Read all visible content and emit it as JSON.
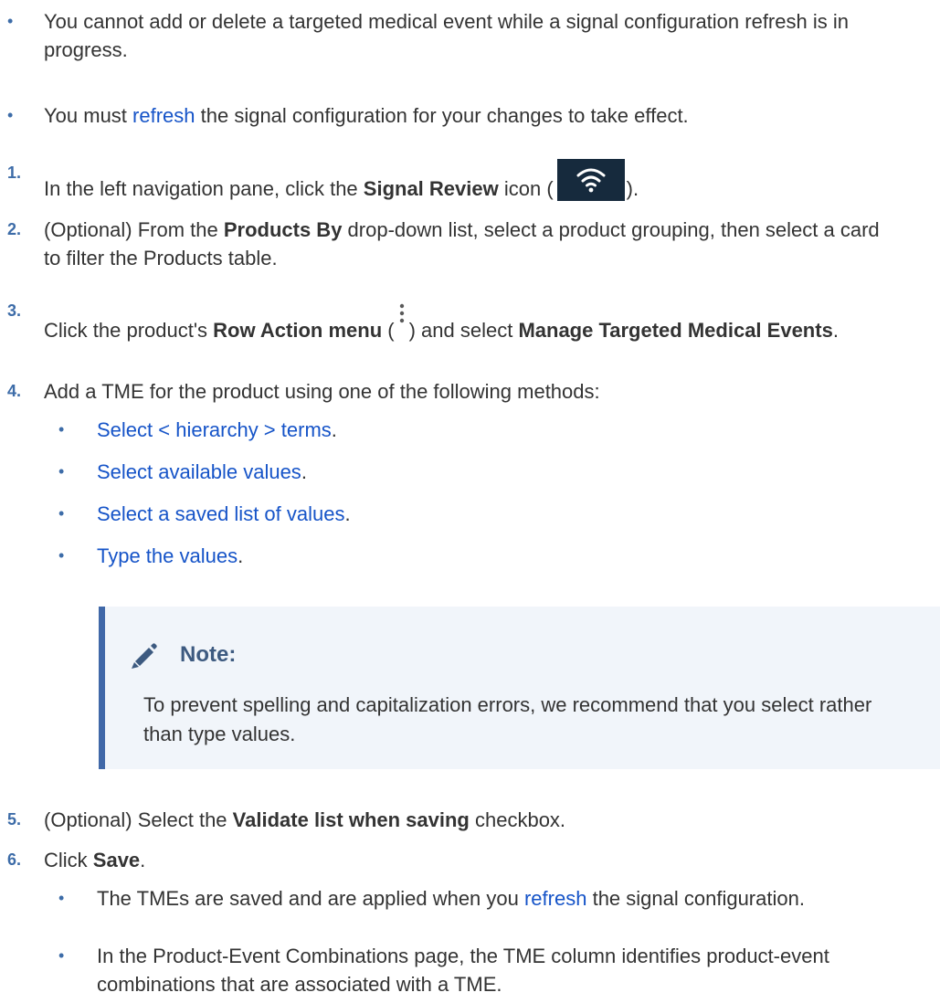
{
  "bullets_top": [
    {
      "text": "You cannot add or delete a targeted medical event while a signal configuration refresh is in progress."
    },
    {
      "pre": "You must ",
      "link": "refresh",
      "post": " the signal configuration for your changes to take effect."
    }
  ],
  "steps": {
    "s1": {
      "number": "1.",
      "pre": "In the left navigation pane, click the ",
      "bold": "Signal Review",
      "mid": " icon (",
      "post": ")."
    },
    "s2": {
      "number": "2.",
      "pre": "(Optional) From the ",
      "bold": "Products By",
      "post": " drop-down list, select a product grouping, then select a card to filter the Products table."
    },
    "s3": {
      "number": "3.",
      "pre": "Click the product's ",
      "bold": "Row Action menu",
      "mid1": " (",
      "mid2": ") and select ",
      "bold2": "Manage Targeted Medical Events",
      "post": "."
    },
    "s4": {
      "number": "4.",
      "text": "Add a TME for the product using one of the following methods:"
    },
    "s5": {
      "number": "5.",
      "pre": "(Optional) Select the ",
      "bold": "Validate list when saving",
      "post": " checkbox."
    },
    "s6": {
      "number": "6.",
      "pre": "Click ",
      "bold": "Save",
      "post": "."
    }
  },
  "methods": [
    {
      "link": "Select < hierarchy > terms",
      "post": "."
    },
    {
      "link": "Select available values",
      "post": "."
    },
    {
      "link": "Select a saved list of values",
      "post": "."
    },
    {
      "link": "Type the values",
      "post": "."
    }
  ],
  "note": {
    "title": "Note:",
    "body": "To prevent spelling and capitalization errors, we recommend that you select rather than type values."
  },
  "save_results": [
    {
      "pre": "The TMEs are saved and are applied when you ",
      "link": "refresh",
      "post": " the signal configuration."
    },
    {
      "text": "In the Product-Event Combinations page, the TME column identifies product-event combinations that are associated with a TME."
    }
  ],
  "bullet_glyph": "•",
  "icons": {
    "signal_review": "wifi-icon",
    "row_action": "kebab-menu-icon",
    "note": "pencil-icon"
  },
  "colors": {
    "link": "#1654c8",
    "marker": "#3d6ca8",
    "note_border": "#4068a8",
    "note_bg": "#f1f5fa",
    "icon_bg": "#162a3d"
  }
}
